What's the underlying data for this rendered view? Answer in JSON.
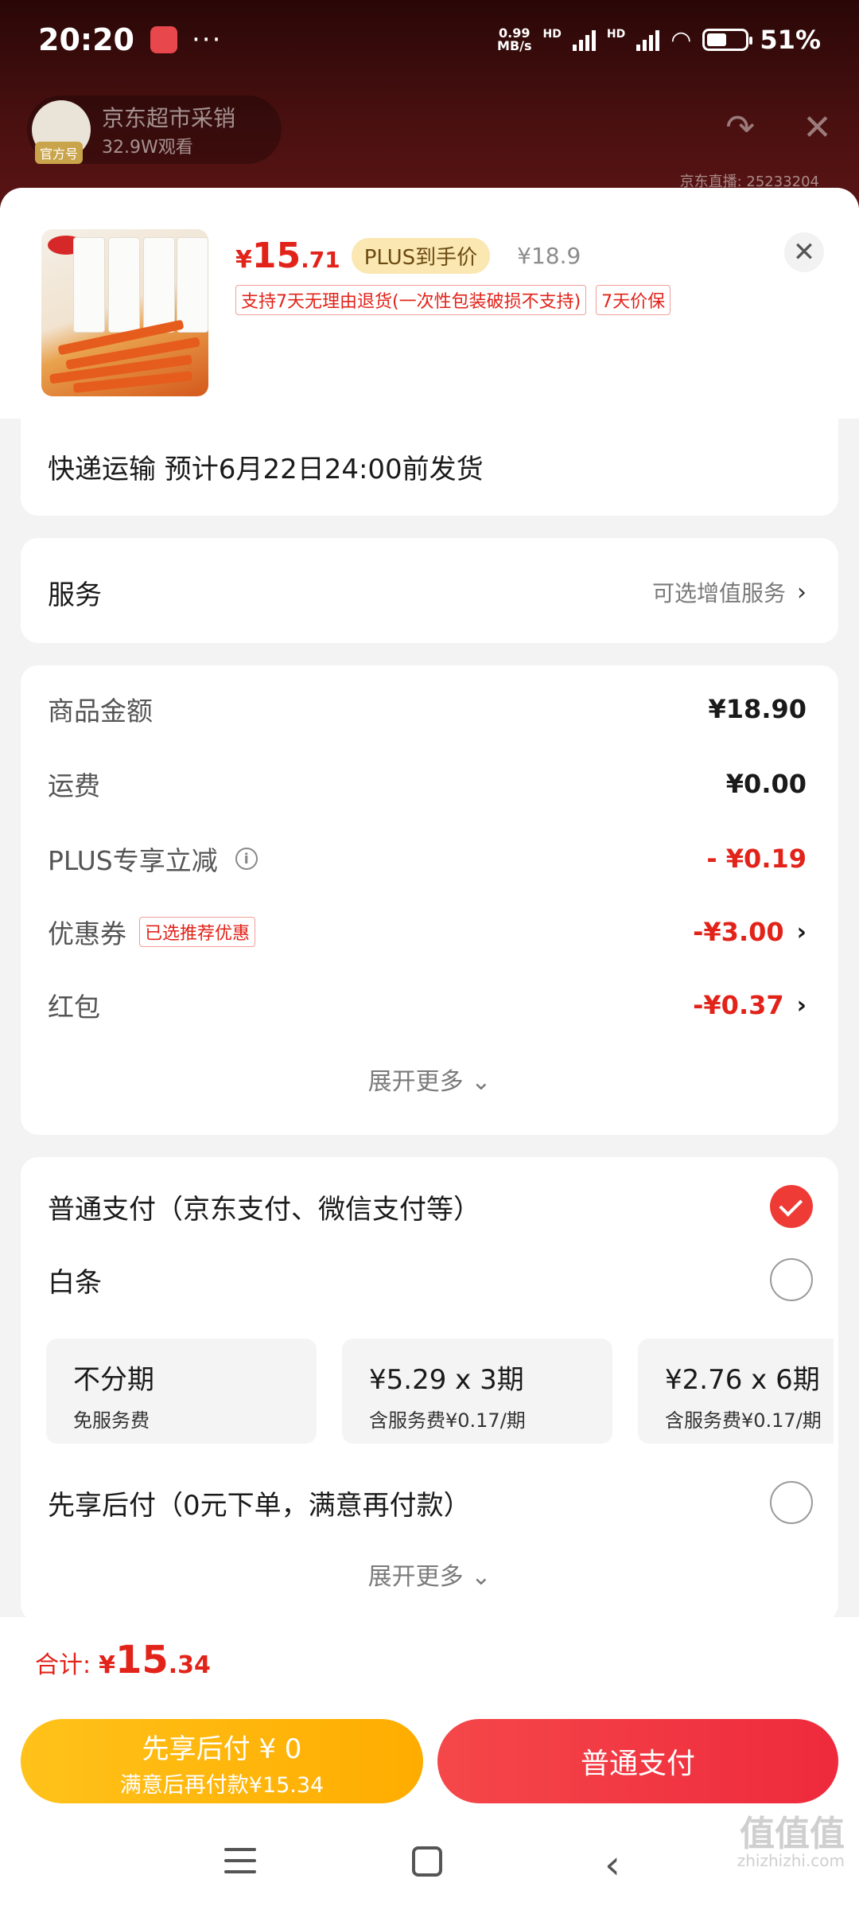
{
  "status_bar": {
    "time": "20:20",
    "dots": "···",
    "net_speed_value": "0.99",
    "net_speed_unit": "MB/s",
    "hd1": "HD",
    "hd2": "HD",
    "battery_percent": "51%",
    "battery_level": 0.51
  },
  "live": {
    "host_name": "京东超市采销",
    "host_views": "32.9W观看",
    "host_tag": "官方号",
    "room_id": "京东直播: 25233204"
  },
  "product": {
    "price_yen": "¥",
    "price_int": "15",
    "price_dec": ".71",
    "plus_badge": "PLUS到手价",
    "original_price": "¥18.9",
    "tags": [
      "支持7天无理由退货(一次性包装破损不支持)",
      "7天价保"
    ],
    "close_icon": "✕"
  },
  "shipping": {
    "text": "快递运输 预计6月22日24:00前发货"
  },
  "service": {
    "label": "服务",
    "option": "可选增值服务",
    "chevron": "›"
  },
  "costs": {
    "goods_label": "商品金额",
    "goods_value": "¥18.90",
    "freight_label": "运费",
    "freight_value": "¥0.00",
    "plus_label": "PLUS专享立减",
    "plus_value": "- ¥0.19",
    "coupon_label": "优惠券",
    "coupon_tag": "已选推荐优惠",
    "coupon_value": "-¥3.00",
    "redpacket_label": "红包",
    "redpacket_value": "-¥0.37",
    "expand": "展开更多 ⌄"
  },
  "payment": {
    "normal_label": "普通支付（京东支付、微信支付等）",
    "baitiao_label": "白条",
    "installments": [
      {
        "title": "不分期",
        "sub": "免服务费"
      },
      {
        "title": "¥5.29 x 3期",
        "sub": "含服务费¥0.17/期"
      },
      {
        "title": "¥2.76 x 6期",
        "sub": "含服务费¥0.17/期"
      }
    ],
    "later_label": "先享后付（0元下单，满意再付款）",
    "expand": "展开更多 ⌄"
  },
  "footer": {
    "total_label": "合计:",
    "total_yen": "¥",
    "total_int": "15",
    "total_dec": ".34",
    "later_button_main": "先享后付 ¥ 0",
    "later_button_sub": "满意后再付款¥15.34",
    "normal_button": "普通支付"
  },
  "watermark": {
    "main": "值值值",
    "sub": "zhizhizhi.com"
  },
  "colors": {
    "accent_red": "#e2231a",
    "pay_red": "#ee2a3c",
    "pay_yellow": "#ffb300"
  }
}
